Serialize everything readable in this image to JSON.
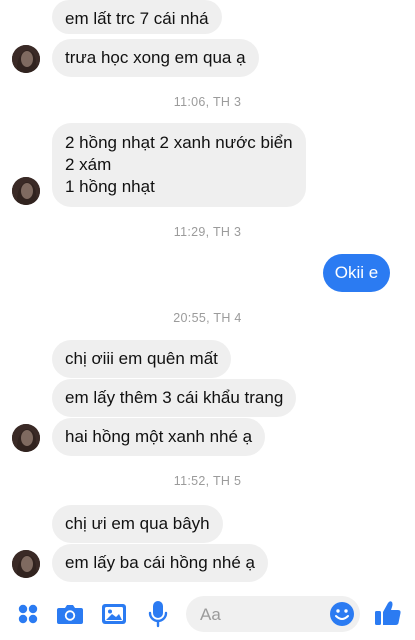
{
  "conversation": {
    "messages": [
      {
        "text": "em lất trc 7 cái nhá"
      },
      {
        "text": "trưa học xong em qua ạ"
      },
      {
        "text": "2 hồng nhạt 2 xanh nước biển\n2 xám\n1 hồng nhạt"
      },
      {
        "text": "Okii e"
      },
      {
        "text": "chị ơiii em quên mất"
      },
      {
        "text": "em lấy thêm 3 cái khẩu trang"
      },
      {
        "text": "hai hồng một xanh nhé ạ"
      },
      {
        "text": "chị ưi em qua bâyh"
      },
      {
        "text": "em lấy ba cái hồng nhé ạ"
      }
    ],
    "timestamps": [
      "11:06, TH 3",
      "11:29, TH 3",
      "20:55, TH 4",
      "11:52, TH 5"
    ]
  },
  "composer": {
    "placeholder": "Aa",
    "icons": [
      "menu-dots-icon",
      "camera-icon",
      "photo-icon",
      "microphone-icon",
      "emoji-icon",
      "thumbs-up-icon"
    ]
  },
  "colors": {
    "accent": "#2b7bf2",
    "incoming_bubble": "#efefef",
    "timestamp_text": "#9b9b9b"
  }
}
